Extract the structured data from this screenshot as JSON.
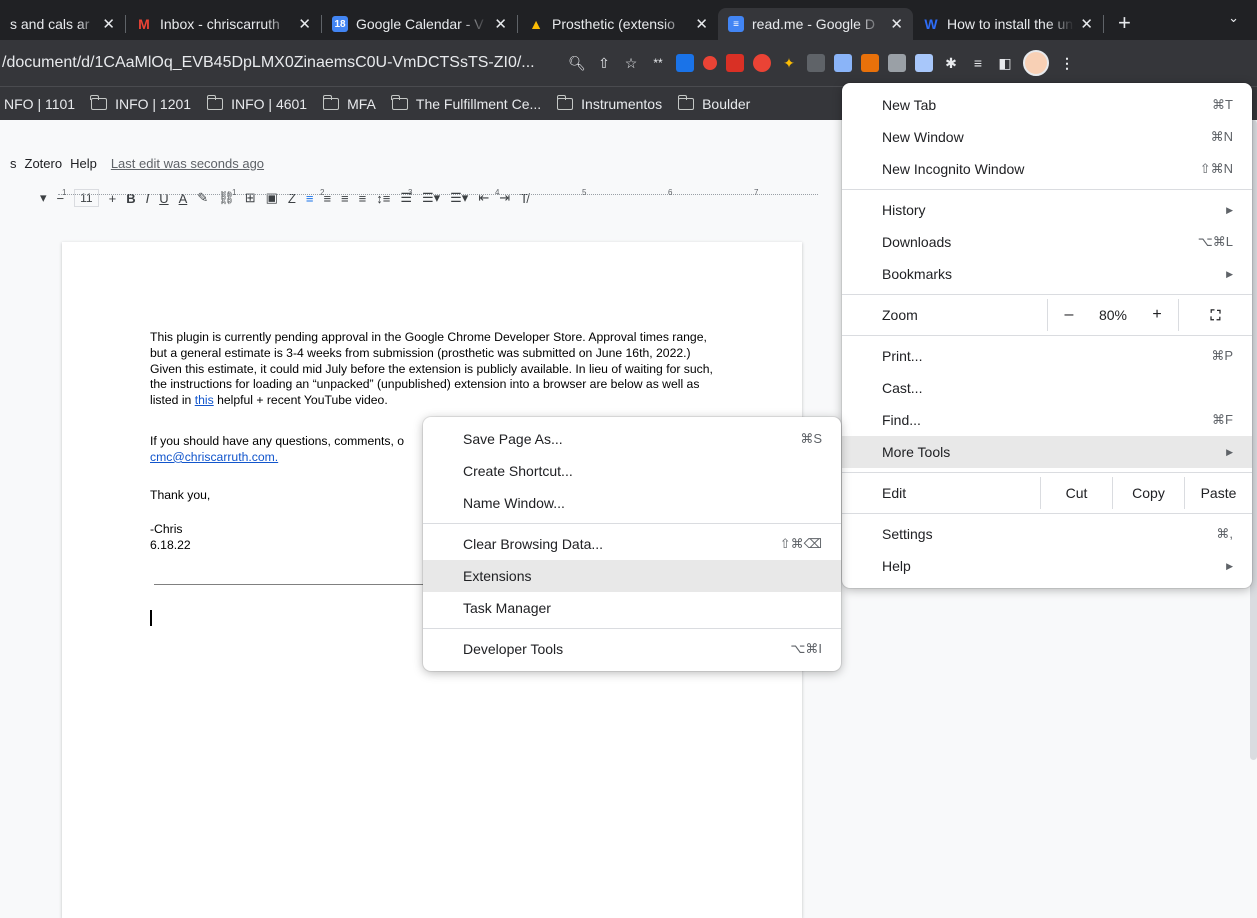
{
  "tabs": [
    {
      "title": "s and cals ar",
      "icon": "",
      "icon_color": "#35363a"
    },
    {
      "title": "Inbox - chriscarruth",
      "icon": "M",
      "icon_color": "#ea4335"
    },
    {
      "title": "Google Calendar - V",
      "icon": "18",
      "icon_color": "#4285f4"
    },
    {
      "title": "Prosthetic (extensio",
      "icon": "▲",
      "icon_color": "#fbbc04"
    },
    {
      "title": "read.me - Google D",
      "icon": "≡",
      "icon_color": "#4285f4",
      "active": true
    },
    {
      "title": "How to install the un",
      "icon": "W",
      "icon_color": "#2e6cf6"
    }
  ],
  "toolbar": {
    "url": "/document/d/1CAaMlOq_EVB45DpLMX0ZinaemsC0U-VmDCTSsTS-ZI0/..."
  },
  "bookmarks": [
    {
      "label": "NFO | 1101",
      "folder": false
    },
    {
      "label": "INFO | 1201",
      "folder": true
    },
    {
      "label": "INFO | 4601",
      "folder": true
    },
    {
      "label": "MFA",
      "folder": true
    },
    {
      "label": "The Fulfillment Ce...",
      "folder": true
    },
    {
      "label": "Instrumentos",
      "folder": true
    },
    {
      "label": "Boulder",
      "folder": true
    }
  ],
  "docs": {
    "menu_items": [
      "s",
      "Zotero",
      "Help"
    ],
    "last_edit": "Last edit was seconds ago",
    "font_size": "11",
    "ruler_numbers": [
      "1",
      "1",
      "2",
      "3",
      "4",
      "5",
      "6",
      "7"
    ],
    "para1_a": "This plugin is currently pending approval in the Google Chrome Developer Store.  Approval times range, but a general estimate is 3-4 weeks from submission (prosthetic was submitted on June 16th, 2022.)  Given this estimate, it could mid July before the extension is publicly available.  In lieu of waiting for such, the instructions for loading an “unpacked” (unpublished) extension into a browser are below as well as listed in ",
    "para1_link": "this",
    "para1_b": " helpful + recent YouTube video.",
    "para2_a": "If you should have any questions, comments, o",
    "para2_link": "cmc@chriscarruth.com.",
    "thanks": "Thank you,",
    "sign_name": "-Chris",
    "sign_date": "6.18.22"
  },
  "chrome_menu": {
    "new_tab": {
      "label": "New Tab",
      "shortcut": "⌘T"
    },
    "new_window": {
      "label": "New Window",
      "shortcut": "⌘N"
    },
    "new_incognito": {
      "label": "New Incognito Window",
      "shortcut": "⇧⌘N"
    },
    "history": {
      "label": "History"
    },
    "downloads": {
      "label": "Downloads",
      "shortcut": "⌥⌘L"
    },
    "bookmarks": {
      "label": "Bookmarks"
    },
    "zoom": {
      "label": "Zoom",
      "minus": "–",
      "value": "80%",
      "plus": "+"
    },
    "print": {
      "label": "Print...",
      "shortcut": "⌘P"
    },
    "cast": {
      "label": "Cast..."
    },
    "find": {
      "label": "Find...",
      "shortcut": "⌘F"
    },
    "more_tools": {
      "label": "More Tools"
    },
    "edit": {
      "label": "Edit",
      "cut": "Cut",
      "copy": "Copy",
      "paste": "Paste"
    },
    "settings": {
      "label": "Settings",
      "shortcut": "⌘,"
    },
    "help": {
      "label": "Help"
    }
  },
  "more_tools_menu": {
    "save_page": {
      "label": "Save Page As...",
      "shortcut": "⌘S"
    },
    "create_shortcut": {
      "label": "Create Shortcut..."
    },
    "name_window": {
      "label": "Name Window..."
    },
    "clear_browsing": {
      "label": "Clear Browsing Data...",
      "shortcut": "⇧⌘⌫"
    },
    "extensions": {
      "label": "Extensions"
    },
    "task_manager": {
      "label": "Task Manager"
    },
    "developer_tools": {
      "label": "Developer Tools",
      "shortcut": "⌥⌘I"
    }
  }
}
